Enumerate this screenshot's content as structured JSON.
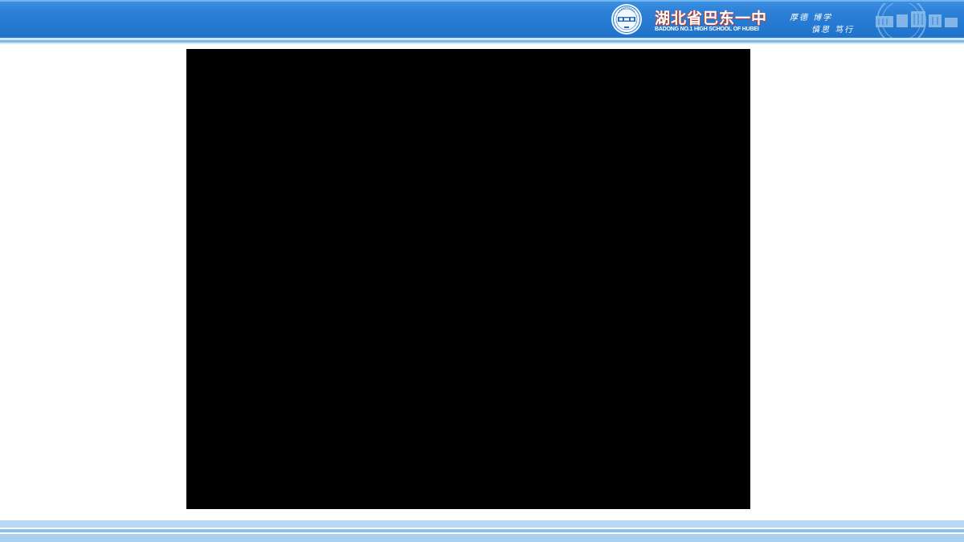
{
  "header": {
    "school_name_cn": "湖北省巴东一中",
    "school_name_en": "BADONG NO.1 HIGH SCHOOL OF HUBEI",
    "motto_line_1": "厚德 博学",
    "motto_line_2": "慎思 笃行",
    "emblem_icon": "school-emblem-seal",
    "watermark_icon": "campus-buildings-watermark"
  },
  "colors": {
    "banner_blue": "#1f72c9",
    "stripe_light": "#cfe6fa",
    "accent_red": "#c0392b",
    "content_background": "#000000"
  },
  "content": {
    "image_icon": "black-image-placeholder"
  }
}
